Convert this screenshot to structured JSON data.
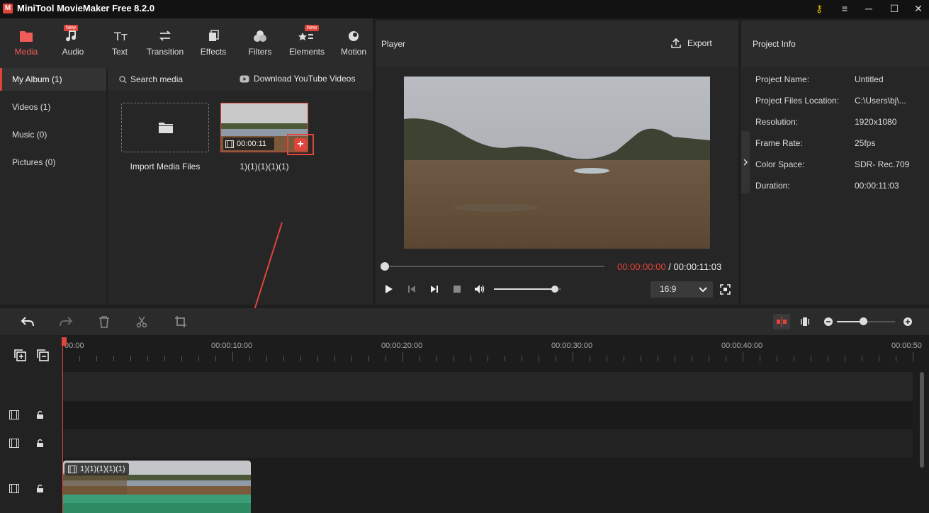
{
  "app": {
    "title": "MiniTool MovieMaker Free 8.2.0",
    "logo_letter": "M"
  },
  "window_controls": {
    "key_icon": "⚷",
    "menu": "≡",
    "minimize": "─",
    "maximize": "☐",
    "close": "✕"
  },
  "toolbar": {
    "new_badge": "New",
    "items": [
      {
        "label": "Media"
      },
      {
        "label": "Audio"
      },
      {
        "label": "Text"
      },
      {
        "label": "Transition"
      },
      {
        "label": "Effects"
      },
      {
        "label": "Filters"
      },
      {
        "label": "Elements"
      },
      {
        "label": "Motion"
      }
    ]
  },
  "sidebar": {
    "items": [
      {
        "label": "My Album (1)"
      },
      {
        "label": "Videos (1)"
      },
      {
        "label": "Music (0)"
      },
      {
        "label": "Pictures (0)"
      }
    ]
  },
  "media": {
    "search_label": "Search media",
    "download_label": "Download YouTube Videos",
    "import_label": "Import Media Files",
    "clip": {
      "name": "1)(1)(1)(1)(1)",
      "duration": "00:00:11"
    }
  },
  "player": {
    "title": "Player",
    "export_label": "Export",
    "current_time": "00:00:00:00",
    "separator": " / ",
    "total_time": "00:00:11:03",
    "aspect_ratio": "16:9",
    "progress": 0,
    "volume": 0.9
  },
  "project_info": {
    "title": "Project Info",
    "rows": [
      {
        "key": "Project Name:",
        "value": "Untitled"
      },
      {
        "key": "Project Files Location:",
        "value": "C:\\Users\\bj\\..."
      },
      {
        "key": "Resolution:",
        "value": "1920x1080"
      },
      {
        "key": "Frame Rate:",
        "value": "25fps"
      },
      {
        "key": "Color Space:",
        "value": "SDR- Rec.709"
      },
      {
        "key": "Duration:",
        "value": "00:00:11:03"
      }
    ]
  },
  "timeline": {
    "ruler": [
      "00:00",
      "00:00:10:00",
      "00:00:20:00",
      "00:00:30:00",
      "00:00:40:00",
      "00:00:50"
    ],
    "clip_name": "1)(1)(1)(1)(1)",
    "zoom_level": 0.45
  },
  "colors": {
    "accent": "#e0453b",
    "audio_track": "#2d8a63"
  }
}
